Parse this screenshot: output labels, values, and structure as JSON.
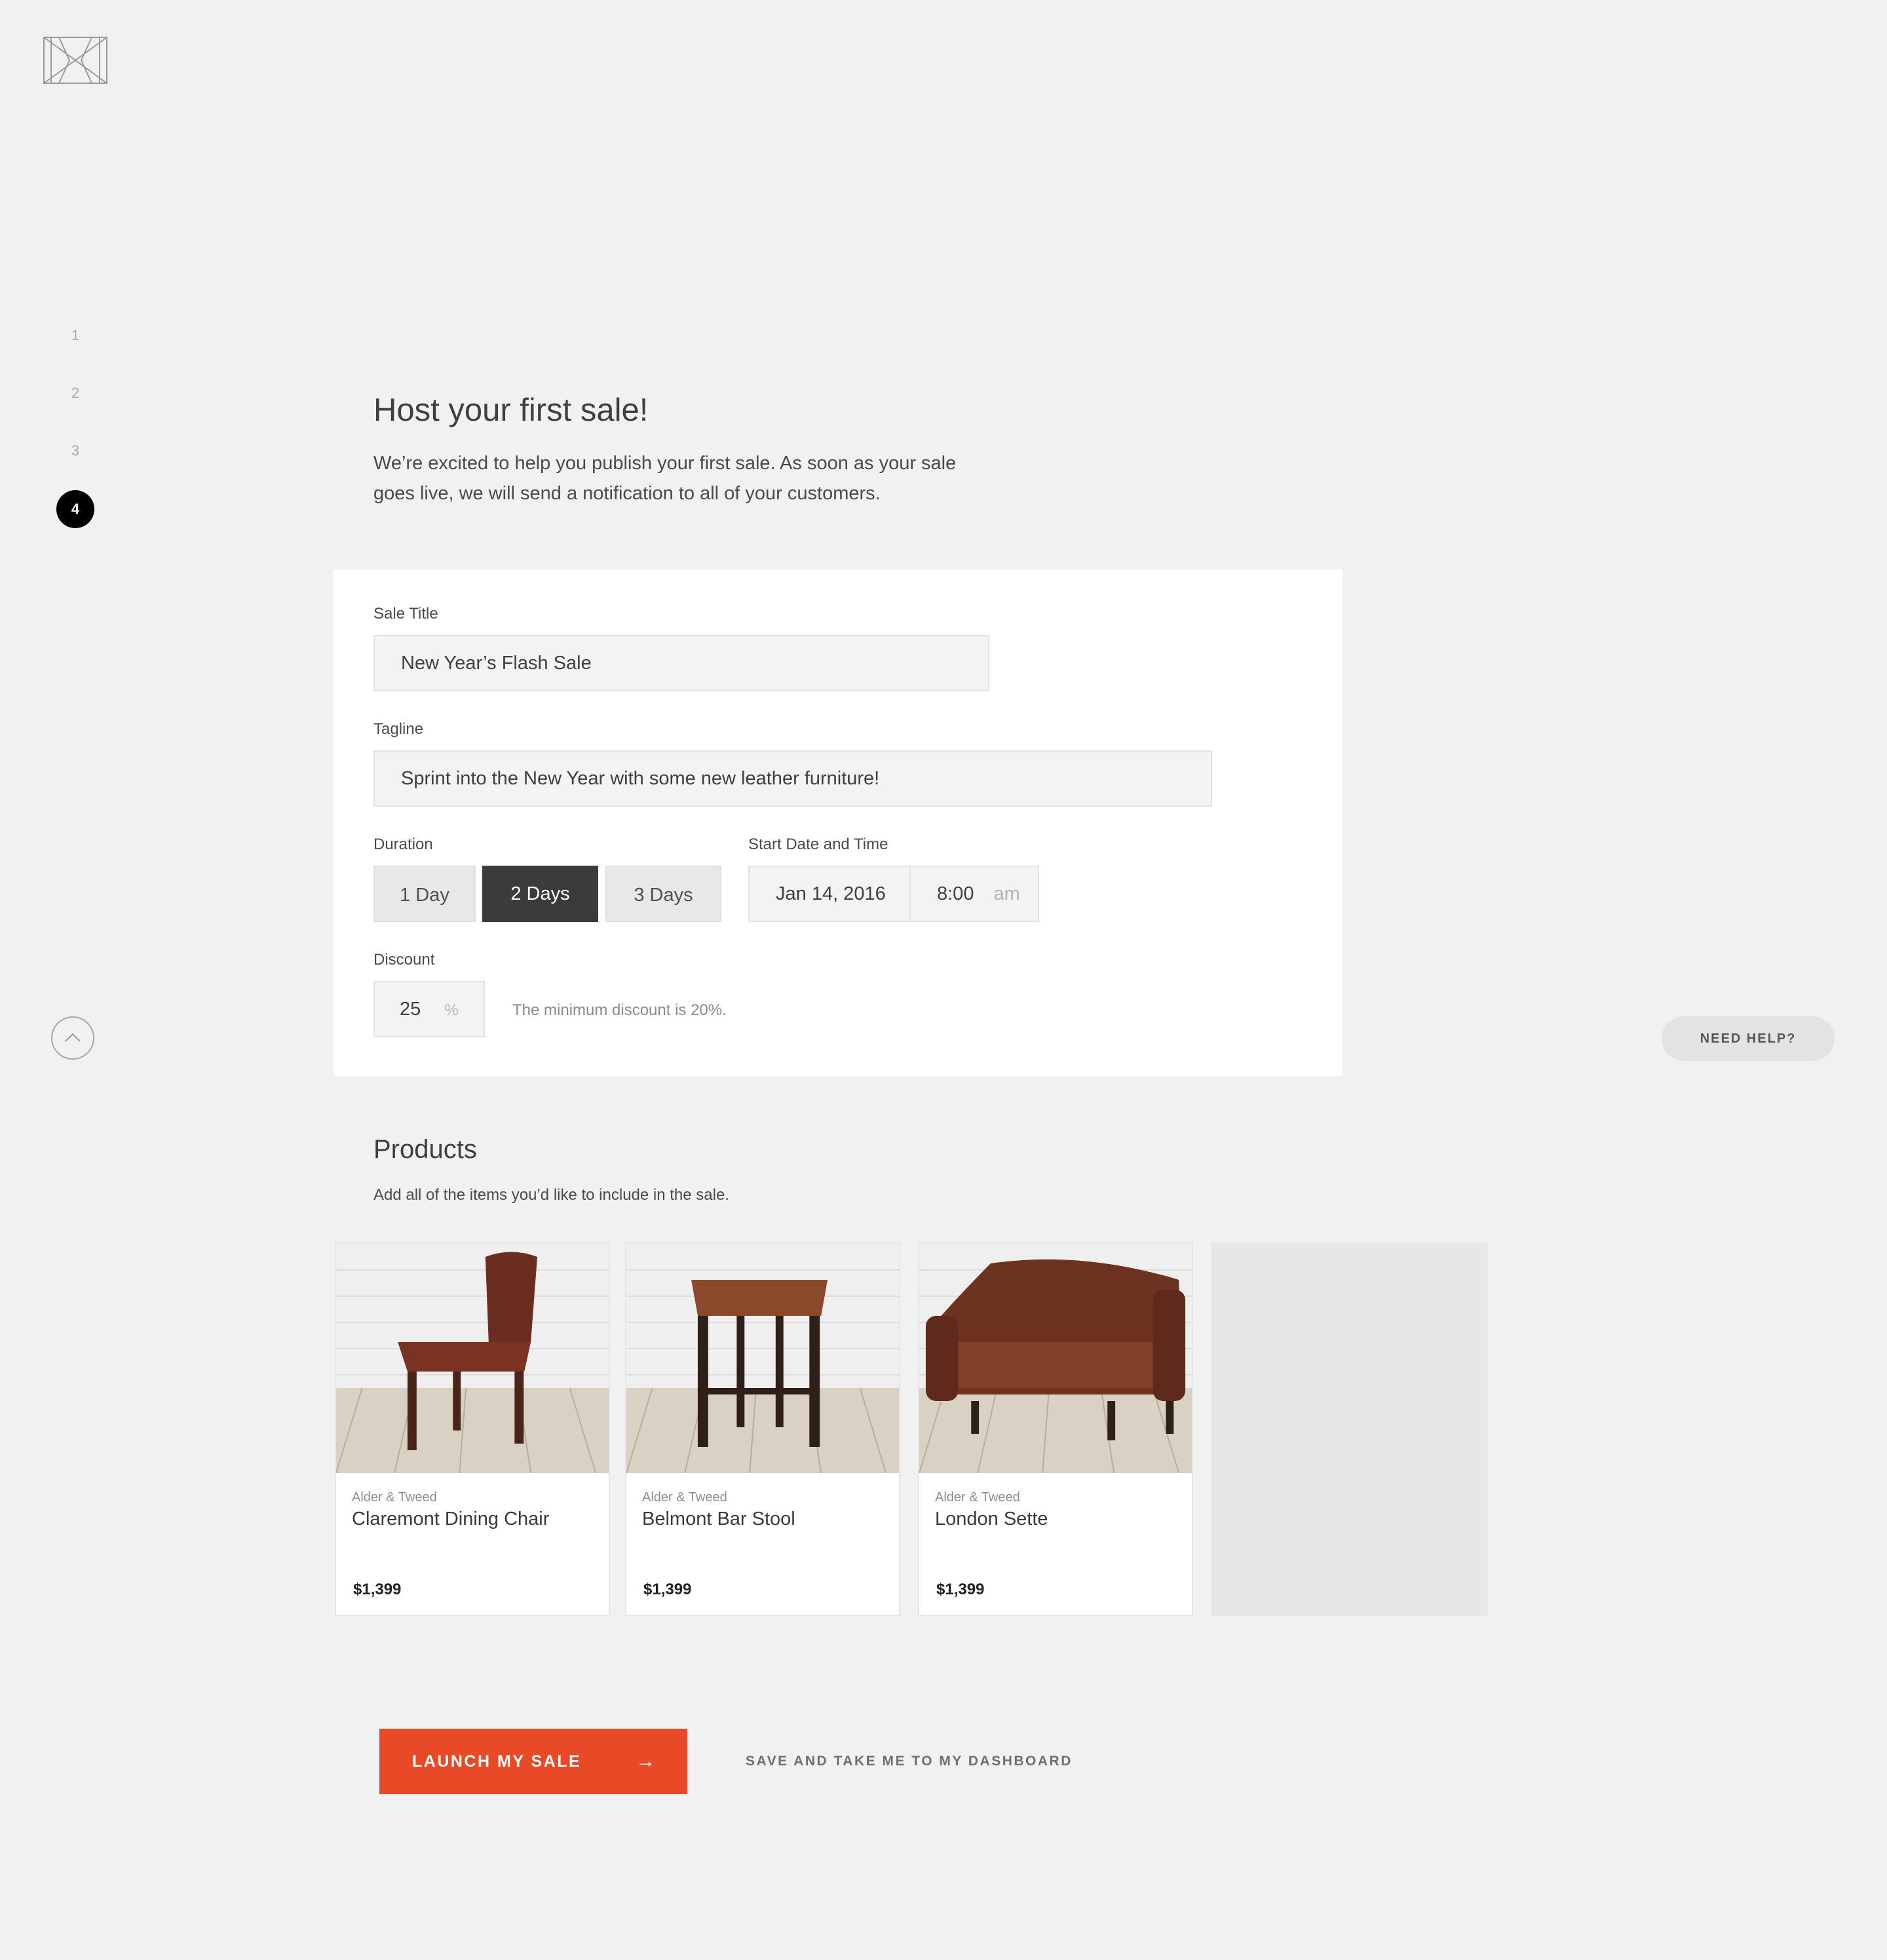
{
  "brand": {
    "logo_icon": "monogram-logo-icon"
  },
  "steps": [
    "1",
    "2",
    "3",
    "4"
  ],
  "active_step": "4",
  "header": {
    "title": "Host your first sale!",
    "intro_line1": "We’re excited to help you publish your first sale. As soon as your sale",
    "intro_line2": "goes live, we will send a notification to all of your customers."
  },
  "form": {
    "sale_title": {
      "label": "Sale Title",
      "value": "New Year’s Flash Sale"
    },
    "tagline": {
      "label": "Tagline",
      "value": "Sprint into the New Year with some new leather furniture!"
    },
    "duration": {
      "label": "Duration",
      "options": [
        "1 Day",
        "2 Days",
        "3 Days"
      ],
      "selected": "2 Days"
    },
    "start": {
      "label": "Start Date and Time",
      "date": "Jan 14, 2016",
      "time": "8:00",
      "meridiem": "am"
    },
    "discount": {
      "label": "Discount",
      "value": "25",
      "unit": "%",
      "hint": "The minimum discount is 20%."
    }
  },
  "products": {
    "title": "Products",
    "subtitle": "Add all of the items you’d like to include in the sale.",
    "items": [
      {
        "brand": "Alder & Tweed",
        "name": "Claremont Dining Chair",
        "price": "$1,399"
      },
      {
        "brand": "Alder & Tweed",
        "name": "Belmont Bar Stool",
        "price": "$1,399"
      },
      {
        "brand": "Alder & Tweed",
        "name": "London Sette",
        "price": "$1,399"
      }
    ]
  },
  "actions": {
    "launch_label": "LAUNCH MY SALE",
    "launch_icon": "arrow-right-icon",
    "save_label": "SAVE AND TAKE ME TO MY DASHBOARD"
  },
  "help": {
    "label": "NEED HELP?"
  },
  "colors": {
    "accent": "#e84a27",
    "selected_segment": "#3b3b3e",
    "background": "#f1f1f1"
  }
}
